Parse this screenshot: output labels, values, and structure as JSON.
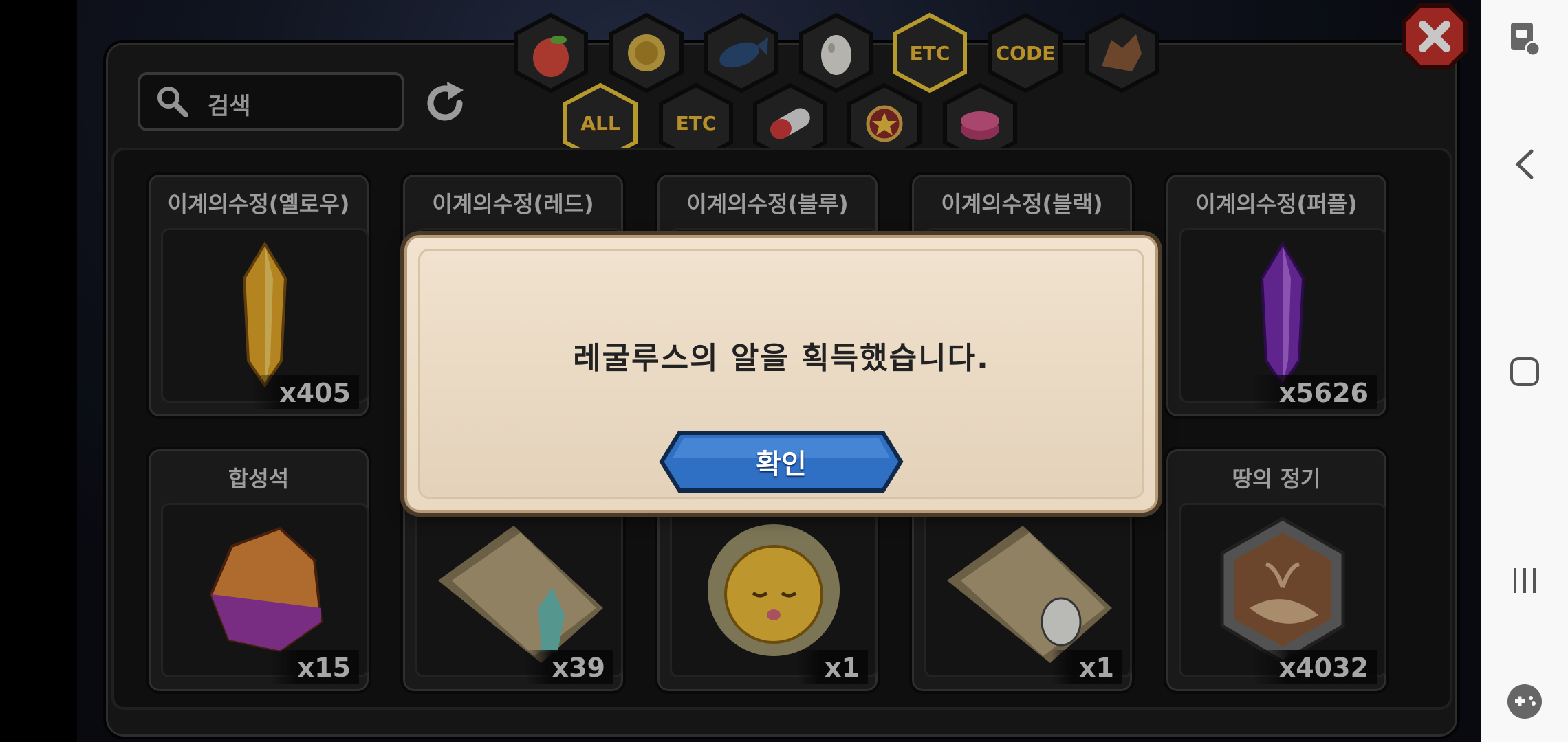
{
  "search": {
    "label": "검색"
  },
  "tabs_row1": [
    {
      "name": "fruit",
      "label": ""
    },
    {
      "name": "coin",
      "label": ""
    },
    {
      "name": "fish",
      "label": ""
    },
    {
      "name": "egg",
      "label": ""
    },
    {
      "name": "etc",
      "label": "ETC",
      "selected": true
    },
    {
      "name": "code",
      "label": "CODE"
    },
    {
      "name": "dragon",
      "label": ""
    }
  ],
  "tabs_row2": [
    {
      "name": "all",
      "label": "ALL",
      "selected": true
    },
    {
      "name": "etc",
      "label": "ETC"
    },
    {
      "name": "pill",
      "label": ""
    },
    {
      "name": "medal",
      "label": ""
    },
    {
      "name": "gift",
      "label": ""
    }
  ],
  "items_row1": [
    {
      "name": "이계의수정(옐로우)",
      "count": "x405",
      "icon": "yellow-crystal"
    },
    {
      "name": "이계의수정(레드)",
      "count": "",
      "icon": "red-crystal"
    },
    {
      "name": "이계의수정(블루)",
      "count": "",
      "icon": "blue-crystal"
    },
    {
      "name": "이계의수정(블랙)",
      "count": "",
      "icon": "black-crystal"
    },
    {
      "name": "이계의수정(퍼플)",
      "count": "x5626",
      "icon": "purple-crystal"
    }
  ],
  "items_row2": [
    {
      "name": "합성석",
      "count": "x15",
      "icon": "synthesis-stone"
    },
    {
      "name": "",
      "count": "x39",
      "icon": "map-scroll-blue"
    },
    {
      "name": "",
      "count": "x1",
      "icon": "golden-creature"
    },
    {
      "name": "",
      "count": "x1",
      "icon": "map-scroll-egg"
    },
    {
      "name": "땅의 정기",
      "count": "x4032",
      "icon": "earth-essence"
    }
  ],
  "dialog": {
    "message": "레굴루스의 알을 획득했습니다.",
    "confirm_label": "확인"
  },
  "colors": {
    "accent": "#e8b93a",
    "confirm_blue": "#2f6fc4"
  }
}
